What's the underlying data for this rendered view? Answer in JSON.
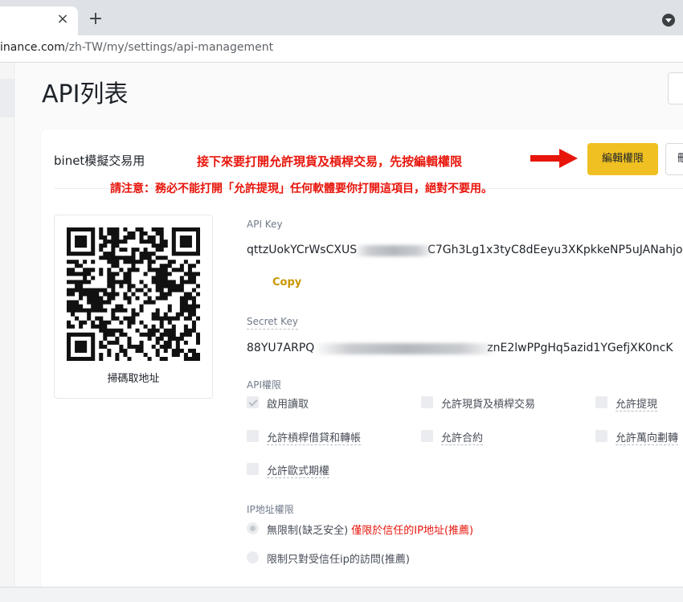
{
  "browser": {
    "tab_close": "×",
    "new_tab": "+",
    "url_main": "inance.com",
    "url_path": "/zh-TW/my/settings/api-management"
  },
  "page": {
    "title": "API列表"
  },
  "api_card": {
    "name": "binet模擬交易用",
    "edit_button": "編輯權限",
    "delete_button": "刪除",
    "qr_caption": "掃碼取地址",
    "api_key_label": "API Key",
    "api_key_value": "qttzUokYCrWsCXUS",
    "api_key_value_tail": "C7Gh3Lg1x3tyC8dEeyu3XKpkkeNP5uJANahjo",
    "copy_label": "Copy",
    "secret_key_label": "Secret Key",
    "secret_key_value": "88YU7ARPQ",
    "secret_key_value_tail": "znE2lwPPgHq5azid1YGefjXK0ncK",
    "permissions_label": "API權限",
    "permissions": [
      {
        "label": "啟用讀取",
        "checked": true
      },
      {
        "label": "允許現貨及槓桿交易",
        "checked": false
      },
      {
        "label": "允許提現",
        "checked": false
      },
      {
        "label": "允許槓桿借貸和轉帳",
        "checked": false
      },
      {
        "label": "允許合約",
        "checked": false
      },
      {
        "label": "允許萬向劃轉",
        "checked": false
      },
      {
        "label": "允許歐式期權",
        "checked": false
      }
    ],
    "ip_label": "IP地址權限",
    "ip_options": [
      {
        "label": "無限制(缺乏安全)",
        "selected": true
      },
      {
        "label": "限制只對受信任ip的訪問(推薦)",
        "selected": false
      }
    ],
    "ip_warning": "僅限於信任的IP地址(推薦)"
  },
  "annotations": {
    "line1": "接下來要打開允許現貨及槓桿交易，先按編輯權限",
    "line2": "請注意：務必不能打開「允許提現」任何軟體要你打開這項目，絕對不要用。",
    "arrow_color": "#e8150b"
  },
  "colors": {
    "brand_yellow": "#f0c022",
    "copy_gold": "#c99400",
    "annotation_red": "#e8150b"
  }
}
